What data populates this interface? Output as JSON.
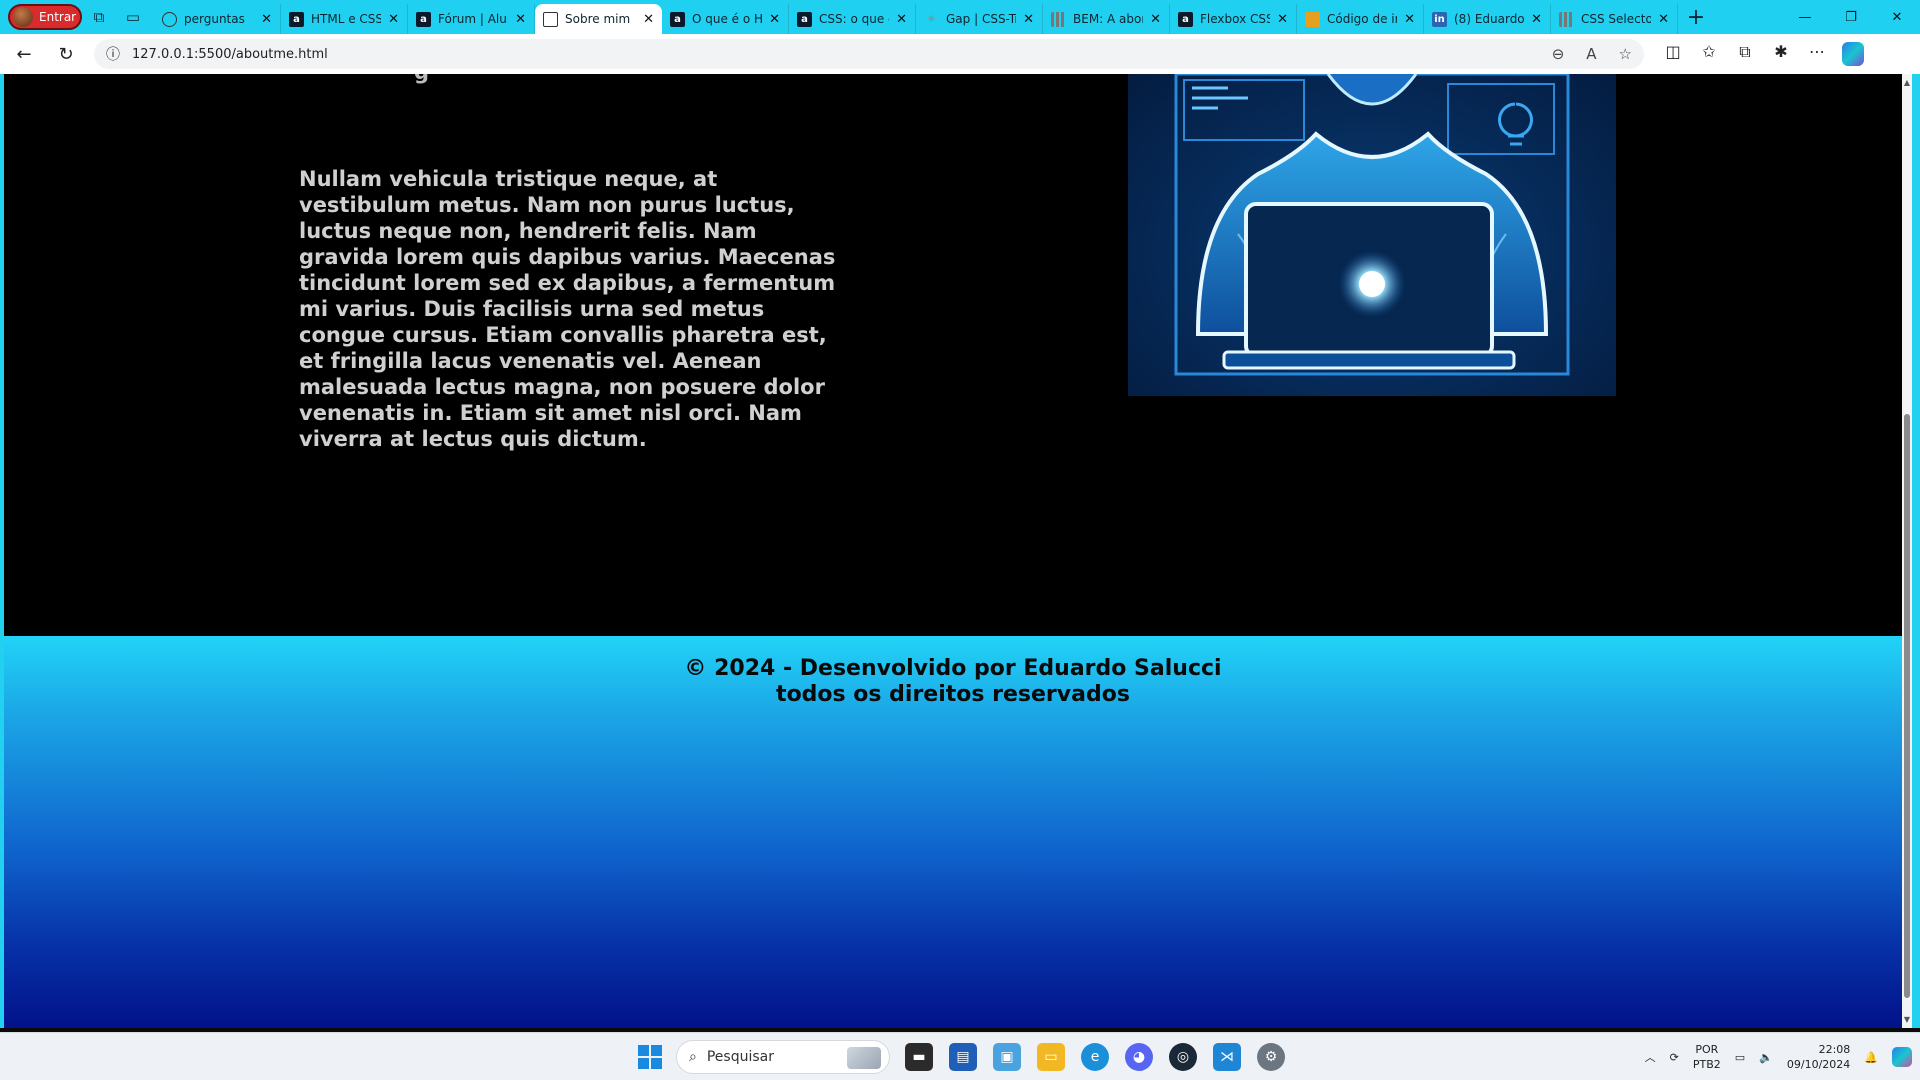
{
  "browser": {
    "profile_label": "Entrar",
    "tabs": [
      {
        "title": "perguntas",
        "favicon": "globe-icon",
        "active": false
      },
      {
        "title": "HTML e CSS:",
        "favicon": "alura-icon",
        "active": false
      },
      {
        "title": "Fórum | Alur",
        "favicon": "alura-icon",
        "active": false
      },
      {
        "title": "Sobre mim",
        "favicon": "document-icon",
        "active": true
      },
      {
        "title": "O que é o H",
        "favicon": "alura-icon",
        "active": false
      },
      {
        "title": "CSS: o que é",
        "favicon": "alura-icon",
        "active": false
      },
      {
        "title": "Gap | CSS-Tri",
        "favicon": "star-icon",
        "active": false
      },
      {
        "title": "BEM: A abor",
        "favicon": "grid-icon",
        "active": false
      },
      {
        "title": "Flexbox CSS:",
        "favicon": "alura-icon",
        "active": false
      },
      {
        "title": "Código de ir",
        "favicon": "code-icon",
        "active": false
      },
      {
        "title": "(8) Eduardo",
        "favicon": "linkedin-icon",
        "active": false
      },
      {
        "title": "CSS Selector",
        "favicon": "grid-icon",
        "active": false
      }
    ],
    "url": "127.0.0.1:5500/aboutme.html"
  },
  "page": {
    "cut_text": "g",
    "about_text": "Nullam vehicula tristique neque, at vestibulum metus. Nam non purus luctus, luctus neque non, hendrerit felis. Nam gravida lorem quis dapibus varius. Maecenas tincidunt lorem sed ex dapibus, a fermentum mi varius. Duis facilisis urna sed metus congue cursus. Etiam convallis pharetra est, et fringilla lacus venenatis vel. Aenean malesuada lectus magna, non posuere dolor venenatis in. Etiam sit amet nisl orci. Nam viverra at lectus quis dictum.",
    "footer_line1": "© 2024 - Desenvolvido por Eduardo Salucci",
    "footer_line2": "todos os direitos reservados"
  },
  "taskbar": {
    "search_placeholder": "Pesquisar",
    "lang_line1": "POR",
    "lang_line2": "PTB2",
    "time": "22:08",
    "date": "09/10/2024"
  },
  "colors": {
    "tabbar": "#20d0f0",
    "page_bg": "#000000",
    "footer_top": "#22d3f7",
    "footer_bottom": "#02128a",
    "text": "#d0d0d0"
  }
}
